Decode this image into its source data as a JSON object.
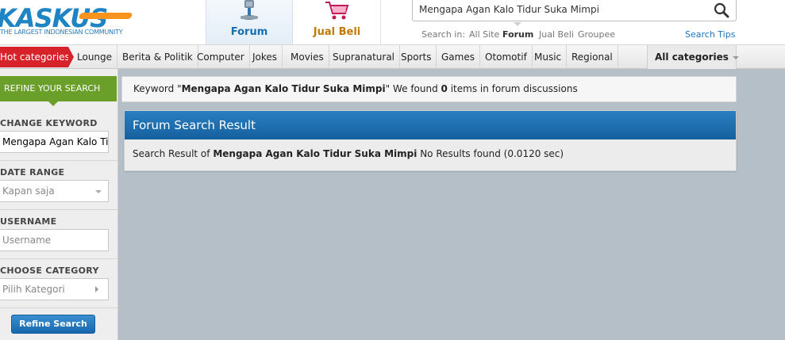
{
  "logo": {
    "text": "KASKUS",
    "tagline": "THE LARGEST INDONESIAN COMMUNITY"
  },
  "nav": {
    "forum_label": "Forum",
    "jualbeli_label": "Jual Beli"
  },
  "search": {
    "query": "Mengapa Agan Kalo Tidur Suka Mimpi",
    "search_in_label": "Search in:",
    "options": [
      "All Site",
      "Forum",
      "Jual Beli",
      "Groupee"
    ],
    "active_option": "Forum",
    "tips_label": "Search Tips"
  },
  "categories": {
    "hot_label": "Hot categories",
    "items": [
      "Lounge",
      "Berita & Politik",
      "Computer",
      "Jokes",
      "Movies",
      "Supranatural",
      "Sports",
      "Games",
      "Otomotif",
      "Music",
      "Regional"
    ],
    "all_label": "All categories"
  },
  "sidebar": {
    "refine_header": "REFINE YOUR SEARCH",
    "change_keyword_label": "CHANGE KEYWORD",
    "keyword_value": "Mengapa Agan Kalo Tidur Suka Mimpi",
    "date_range_label": "DATE RANGE",
    "date_range_value": "Kapan saja",
    "username_label": "USERNAME",
    "username_placeholder": "Username",
    "category_label": "CHOOSE CATEGORY",
    "category_value": "Pilih Kategori",
    "refine_button": "Refine Search"
  },
  "keyword_bar": {
    "prefix": "Keyword \"",
    "keyword": "Mengapa Agan Kalo Tidur Suka Mimpi",
    "middle": "\" We found ",
    "count": "0",
    "suffix": " items in forum discussions"
  },
  "results": {
    "title": "Forum Search Result",
    "prefix": "Search Result of ",
    "keyword": "Mengapa Agan Kalo Tidur Suka Mimpi",
    "suffix": " No Results found (0.0120 sec)"
  },
  "colors": {
    "brand_blue": "#1e84c3",
    "brand_orange": "#f7941d",
    "hot_red": "#d8222a",
    "refine_green": "#6a9f2a",
    "panel_blue": "#1b6cab"
  }
}
